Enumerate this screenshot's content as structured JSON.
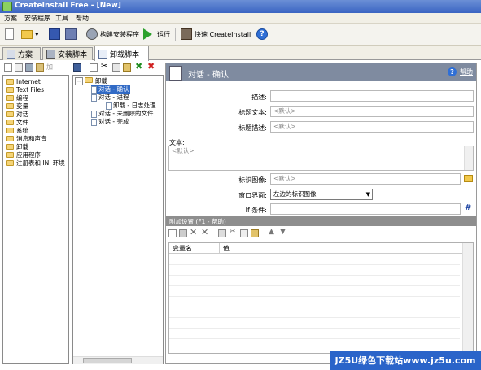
{
  "window": {
    "title": "CreateInstall Free - [New]"
  },
  "menu": {
    "items": [
      "方案",
      "安装程序",
      "工具",
      "帮助"
    ]
  },
  "toolbar": {
    "build_label": "构建安装程序",
    "run_label": "运行",
    "quick_label": "快速 CreateInstall"
  },
  "tabs": [
    "方案",
    "安装脚本",
    "卸载脚本"
  ],
  "sidebar": {
    "add_label": "加",
    "items": [
      "Internet",
      "Text Files",
      "编程",
      "变量",
      "对话",
      "文件",
      "系统",
      "消息和声音",
      "卸载",
      "应用程序",
      "注册表和 INI 环境"
    ]
  },
  "tree": {
    "root": "卸载",
    "nodes": [
      "对话 - 确认",
      "对话 - 进程",
      "卸载 - 日志处理",
      "对话 - 未删除的文件",
      "对话 - 完成"
    ]
  },
  "panel": {
    "title": "对话 - 确认",
    "help_label": "帮助",
    "fields": {
      "desc_label": "描述:",
      "title_text_label": "标题文本:",
      "title_text_value": "<默认>",
      "title_desc_label": "标题描述:",
      "title_desc_value": "<默认>",
      "text_label": "文本:",
      "text_value": "<默认>",
      "logo_label": "标识图像:",
      "logo_value": "<默认>",
      "window_label": "窗口界面:",
      "window_value": "左边的标识图像",
      "if_label": "If 条件:"
    },
    "extra_title": "附加设置 (F1 - 帮助)",
    "grid_headers": [
      "变量名",
      "值"
    ]
  },
  "watermark": {
    "text": "JZ5U绿色下载站www.jz5u.com"
  }
}
